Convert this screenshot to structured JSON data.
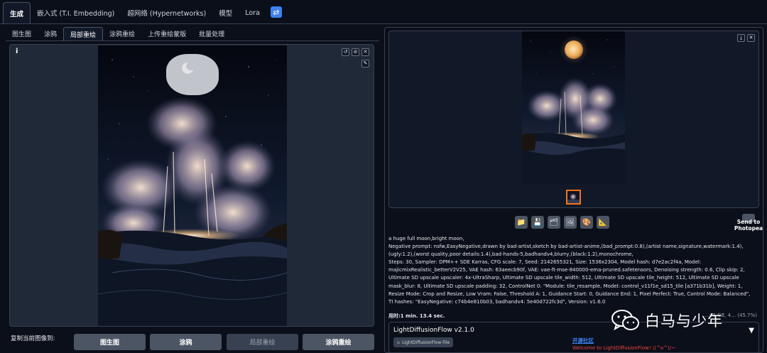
{
  "top_tabs": [
    "生成",
    "嵌入式 (T.I. Embedding)",
    "超网络 (Hypernetworks)",
    "模型",
    "Lora"
  ],
  "sub_tabs": [
    "图生图",
    "涂鸦",
    "局部重绘",
    "涂鸦重绘",
    "上传重绘蒙版",
    "批量处理"
  ],
  "canvas": {
    "info_glyph": "i",
    "tools": [
      "↺",
      "⊘",
      "✕"
    ],
    "brush_glyph": "✎"
  },
  "copy_to": {
    "label": "复制当前图像到:",
    "buttons": [
      "图生图",
      "涂鸦",
      "局部重绘",
      "涂鸦重绘"
    ]
  },
  "gallery": {
    "buttons": [
      "⤓",
      "✕"
    ]
  },
  "actions": {
    "icons": [
      "folder-icon",
      "save-icon",
      "zip-icon",
      "image-icon",
      "palette-icon",
      "ruler-icon"
    ],
    "glyphs": [
      "📁",
      "💾",
      "🗂",
      "🖼",
      "🎨",
      "📐"
    ],
    "send_label": "Send to Photopea"
  },
  "generation_info": {
    "prompt": "a huge full moon,bright moon,",
    "negative": "Negative prompt: nsfw,EasyNegative,drawn by bad-artist,sketch by bad-artist-anime,(bad_prompt:0.8),(artist name,signature,watermark:1.4),(ugly:1.2),(worst quality,poor details:1.4),bad-hands-5,badhandv4,blurry,(black:1.2),monochrome,",
    "params": "Steps: 30, Sampler: DPM++ SDE Karras, CFG scale: 7, Seed: 2142655321, Size: 1536x2304, Model hash: d7e2ac2f4a, Model: majicmixRealistic_betterV2V25, VAE hash: 63aeecb90f, VAE: vae-ft-mse-840000-ema-pruned.safetensors, Denoising strength: 0.6, Clip skip: 2, Ultimate SD upscale upscaler: 4x-UltraSharp, Ultimate SD upscale tile_width: 512, Ultimate SD upscale tile_height: 512, Ultimate SD upscale mask_blur: 8, Ultimate SD upscale padding: 32, ControlNet 0: \"Module: tile_resample, Model: control_v11f1e_sd15_tile [a371b31b], Weight: 1, Resize Mode: Crop and Resize, Low Vram: False, Threshold A: 1, Guidance Start: 0, Guidance End: 1, Pixel Perfect: True, Control Mode: Balanced\", TI hashes: \"EasyNegative: c74b4e810b03, badhandv4: 5e40d722fc3d\", Version: v1.6.0",
    "time": "用时:1 min. 13.4 sec.",
    "memory": "…49 GB, 4… (45.7%)"
  },
  "ldf": {
    "title": "LightDiffusionFlow v2.1.0",
    "file_btn": "LightDiffusionFlow File",
    "link": "开源社区",
    "welcome": "Welcome to LightDiffusionFlow! \\(^o^)/~"
  },
  "watermark": {
    "text": "白马与少年"
  },
  "colors": {
    "accent": "#3b82f6",
    "selected": "#f97316",
    "warning": "#ef4444"
  }
}
